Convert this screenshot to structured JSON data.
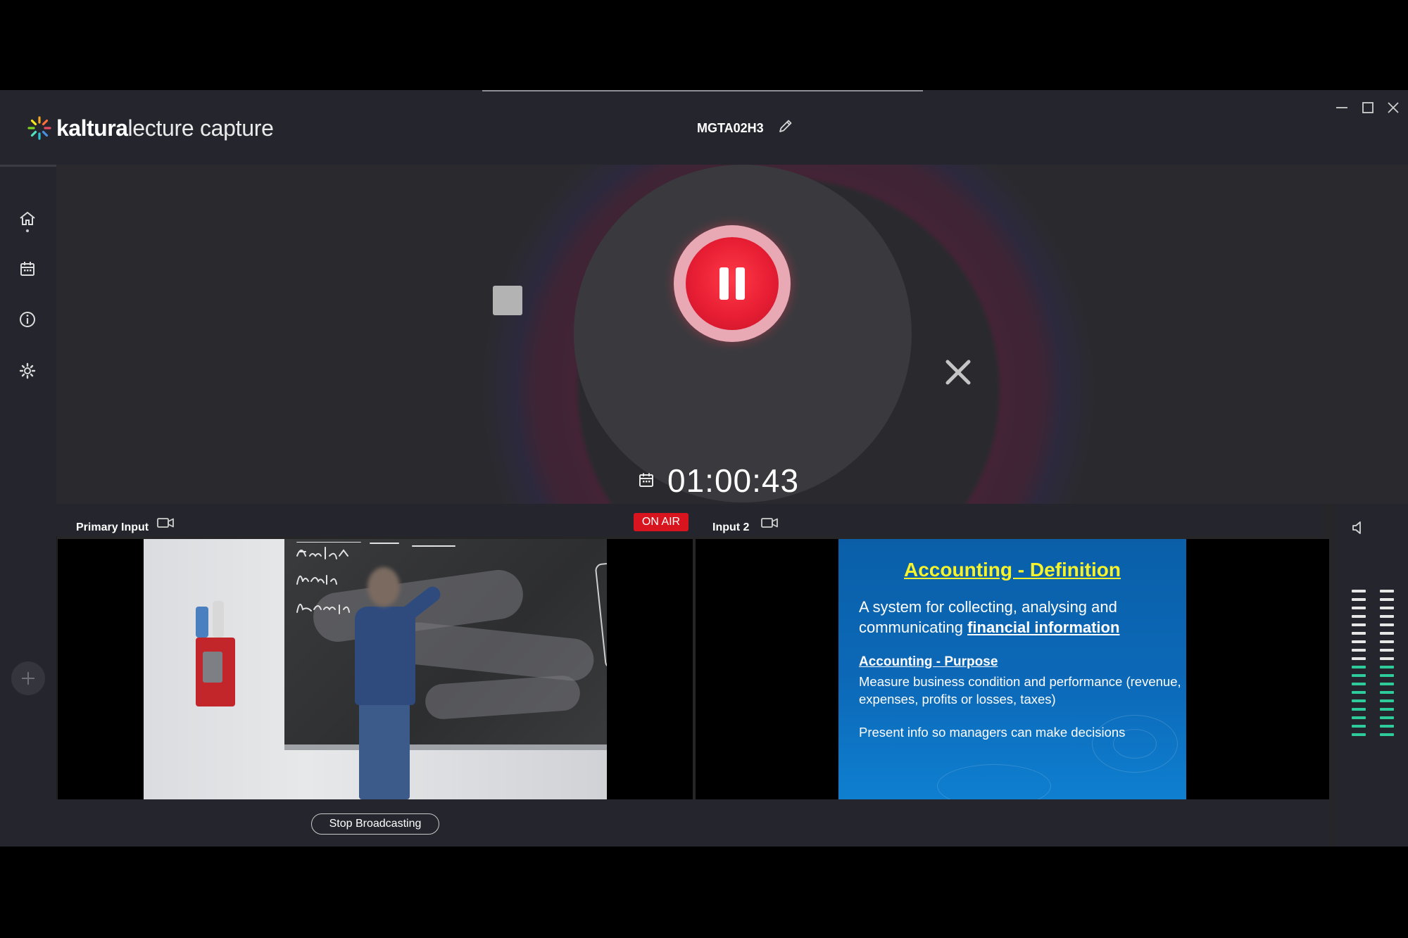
{
  "app": {
    "logo_bold": "kaltura",
    "logo_light": "lecture capture",
    "session_title": "MGTA02H3"
  },
  "recorder": {
    "elapsed": "01:00:43",
    "accent_color": "#e81e34"
  },
  "inputs": {
    "primary_label": "Primary Input",
    "secondary_label": "Input 2",
    "on_air_label": "ON AIR"
  },
  "slide": {
    "title": "Accounting - Definition",
    "p1_prefix": "A system for collecting, analysing and communicating ",
    "p1_emphasis": "financial information",
    "purpose_heading": "Accounting - Purpose",
    "purpose_text": "Measure business condition and performance (revenue, expenses, profits or losses, taxes)",
    "present_text": "Present info so managers can make decisions"
  },
  "controls": {
    "stop_broadcasting_label": "Stop Broadcasting"
  },
  "audio": {
    "left_level": 0.5,
    "right_level": 0.5,
    "active_color": "#2ecc9a",
    "idle_color": "#e6e6e6"
  }
}
